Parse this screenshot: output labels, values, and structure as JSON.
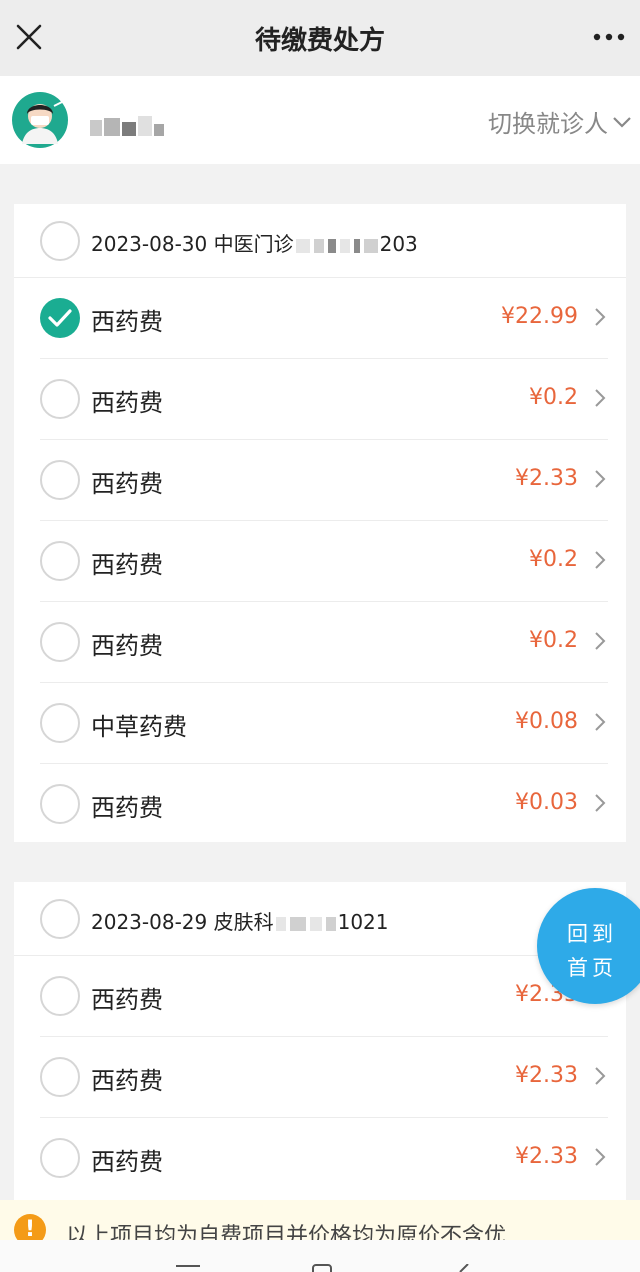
{
  "header": {
    "title": "待缴费处方",
    "close_icon": "close-icon",
    "more_icon": "more-icon"
  },
  "patient": {
    "switch_label": "切换就诊人",
    "switch_icon": "chevron-down-icon"
  },
  "prescriptions": [
    {
      "date_dept": "2023-08-30 中医门诊",
      "suffix": "203",
      "items": [
        {
          "label": "西药费",
          "price": "¥22.99",
          "checked": true
        },
        {
          "label": "西药费",
          "price": "¥0.2",
          "checked": false
        },
        {
          "label": "西药费",
          "price": "¥2.33",
          "checked": false
        },
        {
          "label": "西药费",
          "price": "¥0.2",
          "checked": false
        },
        {
          "label": "西药费",
          "price": "¥0.2",
          "checked": false
        },
        {
          "label": "中草药费",
          "price": "¥0.08",
          "checked": false
        },
        {
          "label": "西药费",
          "price": "¥0.03",
          "checked": false
        }
      ]
    },
    {
      "date_dept": "2023-08-29 皮肤科",
      "suffix": "1021",
      "items": [
        {
          "label": "西药费",
          "price": "¥2.33",
          "checked": false
        },
        {
          "label": "西药费",
          "price": "¥2.33",
          "checked": false
        },
        {
          "label": "西药费",
          "price": "¥2.33",
          "checked": false
        }
      ]
    }
  ],
  "home_button": {
    "line1": "回到",
    "line2": "首页"
  },
  "notice": {
    "text": "以上项目均为自费项目并价格均为原价不含优"
  },
  "colors": {
    "accent": "#1aad92",
    "price": "#e8663c",
    "home_button": "#2eaae8",
    "warning": "#f49b17"
  }
}
